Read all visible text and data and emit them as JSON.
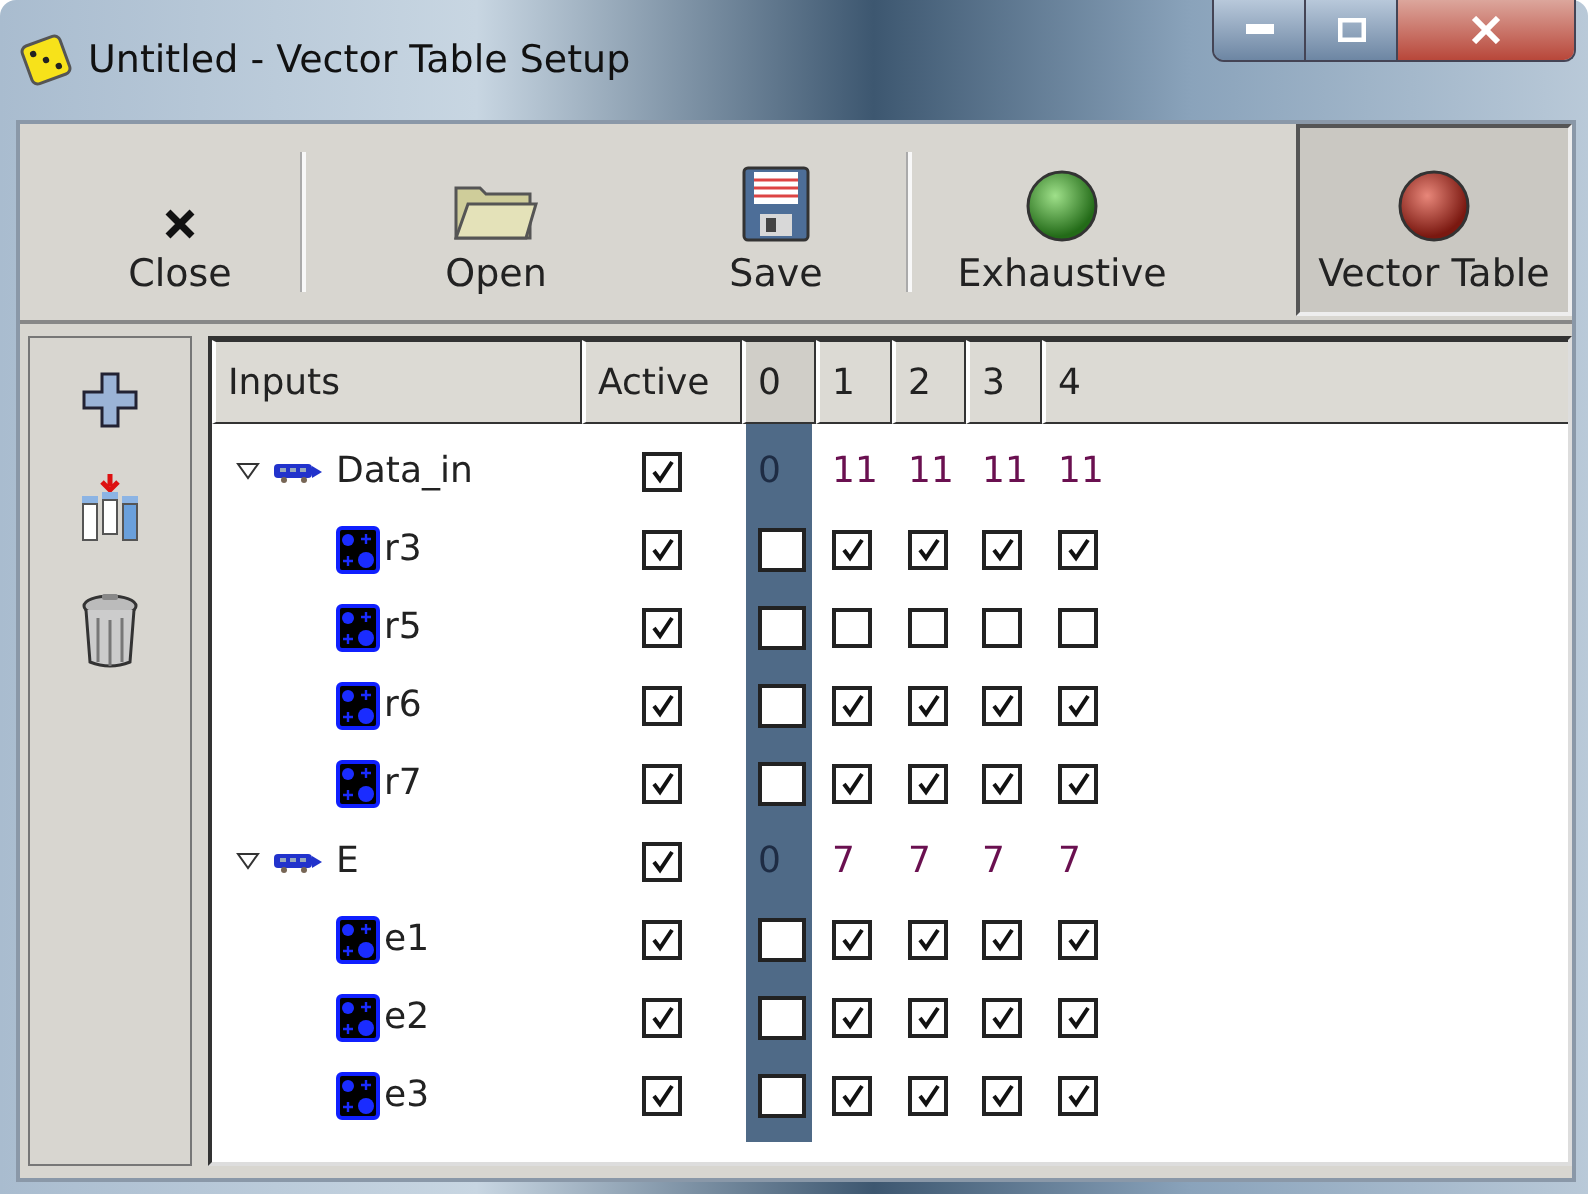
{
  "window": {
    "title": "Untitled - Vector Table Setup"
  },
  "toolbar": [
    {
      "kind": "close",
      "label": "Close",
      "selected": false
    },
    {
      "kind": "open",
      "label": "Open",
      "selected": false
    },
    {
      "kind": "save",
      "label": "Save",
      "selected": false
    },
    {
      "kind": "exhaustive",
      "label": "Exhaustive",
      "selected": false
    },
    {
      "kind": "vector",
      "label": "Vector Table",
      "selected": true
    }
  ],
  "table": {
    "columns": [
      {
        "label": "Inputs",
        "selected": false
      },
      {
        "label": "Active",
        "selected": false
      },
      {
        "label": "0",
        "selected": true
      },
      {
        "label": "1",
        "selected": false
      },
      {
        "label": "2",
        "selected": false
      },
      {
        "label": "3",
        "selected": false
      },
      {
        "label": "4",
        "selected": false
      }
    ],
    "groups": [
      {
        "name": "Data_in",
        "expanded": true,
        "active": true,
        "values": [
          "0",
          "11",
          "11",
          "11",
          "11"
        ],
        "children": [
          {
            "name": "r3",
            "active": true,
            "bits": [
              false,
              true,
              true,
              true,
              true
            ]
          },
          {
            "name": "r5",
            "active": true,
            "bits": [
              false,
              false,
              false,
              false,
              false
            ]
          },
          {
            "name": "r6",
            "active": true,
            "bits": [
              false,
              true,
              true,
              true,
              true
            ]
          },
          {
            "name": "r7",
            "active": true,
            "bits": [
              false,
              true,
              true,
              true,
              true
            ]
          }
        ]
      },
      {
        "name": "E",
        "expanded": true,
        "active": true,
        "values": [
          "0",
          "7",
          "7",
          "7",
          "7"
        ],
        "children": [
          {
            "name": "e1",
            "active": true,
            "bits": [
              false,
              true,
              true,
              true,
              true
            ]
          },
          {
            "name": "e2",
            "active": true,
            "bits": [
              false,
              true,
              true,
              true,
              true
            ]
          },
          {
            "name": "e3",
            "active": true,
            "bits": [
              false,
              true,
              true,
              true,
              true
            ]
          }
        ]
      }
    ]
  }
}
